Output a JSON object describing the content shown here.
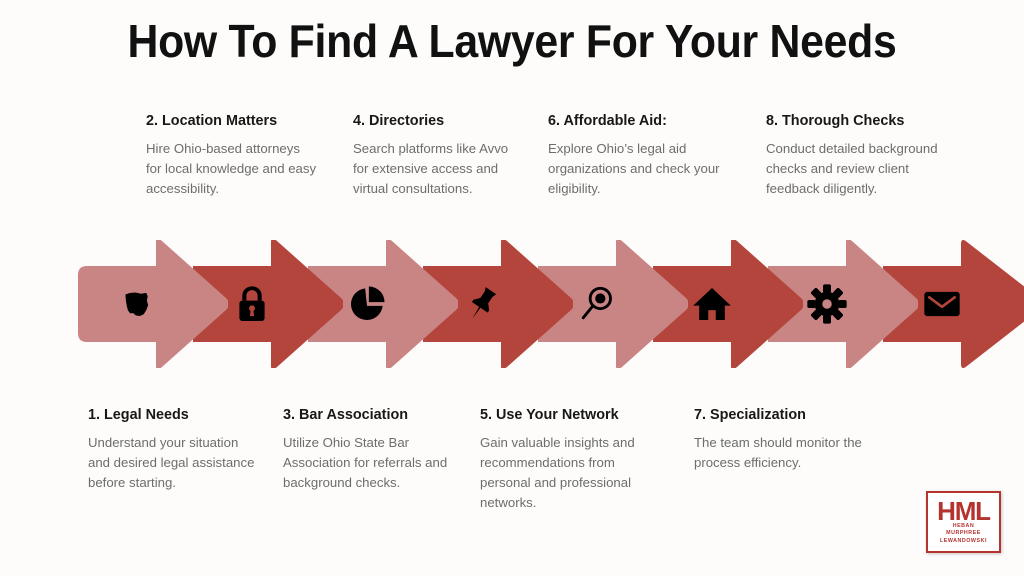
{
  "title": "How To Find A Lawyer For Your Needs",
  "colors": {
    "background": "#fdfcfa",
    "arrow_light": "#c98484",
    "arrow_dark": "#b3453c",
    "title_text": "#111111",
    "heading_text": "#181818",
    "body_text": "#6d6d6d",
    "logo_red": "#b5332e"
  },
  "steps": [
    {
      "number": "1",
      "heading": "1. Legal Needs",
      "description": "Understand your situation and desired legal assistance before starting.",
      "icon": "ohio-state-map-icon",
      "row": "bottom",
      "arrow_shade": "light"
    },
    {
      "number": "2",
      "heading": "2. Location Matters",
      "description": "Hire Ohio-based attorneys for local knowledge and easy accessibility.",
      "icon": "padlock-icon",
      "row": "top",
      "arrow_shade": "dark"
    },
    {
      "number": "3",
      "heading": "3. Bar Association",
      "description": "Utilize Ohio State Bar Association for referrals and background checks.",
      "icon": "pie-chart-icon",
      "row": "bottom",
      "arrow_shade": "light"
    },
    {
      "number": "4",
      "heading": "4. Directories",
      "description": "Search platforms like Avvo for extensive access and virtual consultations.",
      "icon": "pushpin-icon",
      "row": "top",
      "arrow_shade": "dark"
    },
    {
      "number": "5",
      "heading": "5. Use Your Network",
      "description": "Gain valuable insights and recommendations from personal and professional networks.",
      "icon": "magnifying-glass-icon",
      "row": "bottom",
      "arrow_shade": "light"
    },
    {
      "number": "6",
      "heading": "6. Affordable Aid:",
      "description": "Explore Ohio’s legal aid organizations and check your eligibility.",
      "icon": "house-icon",
      "row": "top",
      "arrow_shade": "dark"
    },
    {
      "number": "7",
      "heading": "7. Specialization",
      "description": "The team should monitor the process efficiency.",
      "icon": "gear-icon",
      "row": "bottom",
      "arrow_shade": "light"
    },
    {
      "number": "8",
      "heading": "8. Thorough Checks",
      "description": "Conduct detailed background checks and review client feedback diligently.",
      "icon": "envelope-icon",
      "row": "top",
      "arrow_shade": "dark"
    }
  ],
  "logo": {
    "mark": "HML",
    "line1": "HEBAN",
    "line2": "MURPHREE",
    "line3": "LEWANDOWSKI"
  }
}
